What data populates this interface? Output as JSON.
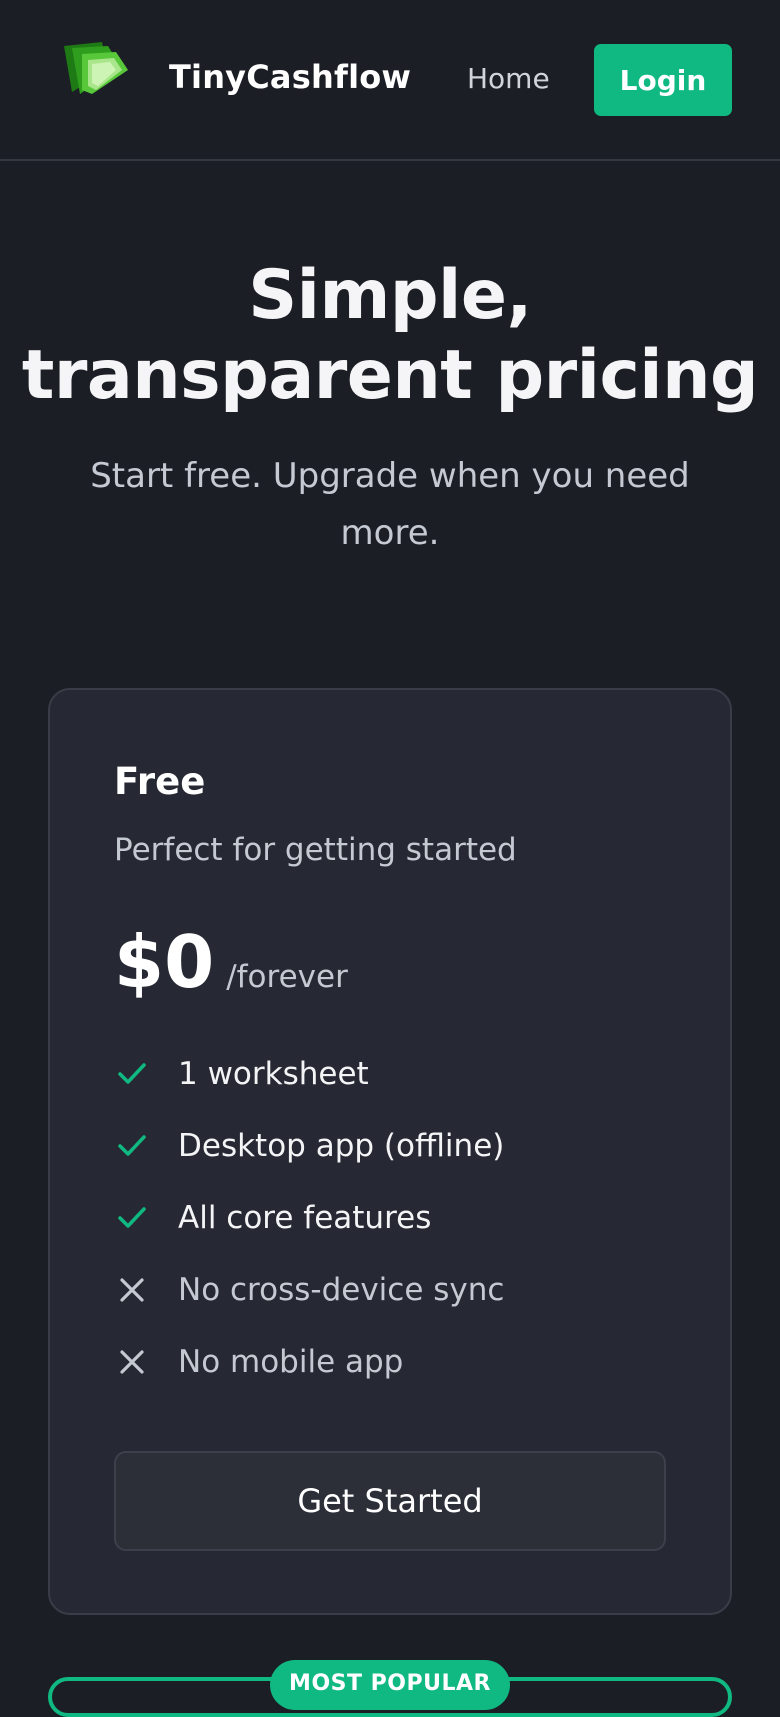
{
  "header": {
    "logo_icon": "money-stack-icon",
    "brand": "TinyCashflow",
    "nav_home": "Home",
    "login_label": "Login"
  },
  "hero": {
    "title_line1": "Simple,",
    "title_line2": "transparent pricing",
    "subtitle": "Start free. Upgrade when you need more."
  },
  "plans": [
    {
      "name": "Free",
      "description": "Perfect for getting started",
      "price": "$0",
      "period": "/forever",
      "features": [
        {
          "text": "1 worksheet",
          "included": true,
          "icon": "check-icon"
        },
        {
          "text": "Desktop app (offline)",
          "included": true,
          "icon": "check-icon"
        },
        {
          "text": "All core features",
          "included": true,
          "icon": "check-icon"
        },
        {
          "text": "No cross-device sync",
          "included": false,
          "icon": "x-icon"
        },
        {
          "text": "No mobile app",
          "included": false,
          "icon": "x-icon"
        }
      ],
      "cta_label": "Get Started"
    }
  ],
  "badge": {
    "label": "MOST POPULAR"
  },
  "colors": {
    "background": "#1c1e25",
    "card": "#262933",
    "accent": "#10b981",
    "text_muted": "#c4c9d2"
  }
}
